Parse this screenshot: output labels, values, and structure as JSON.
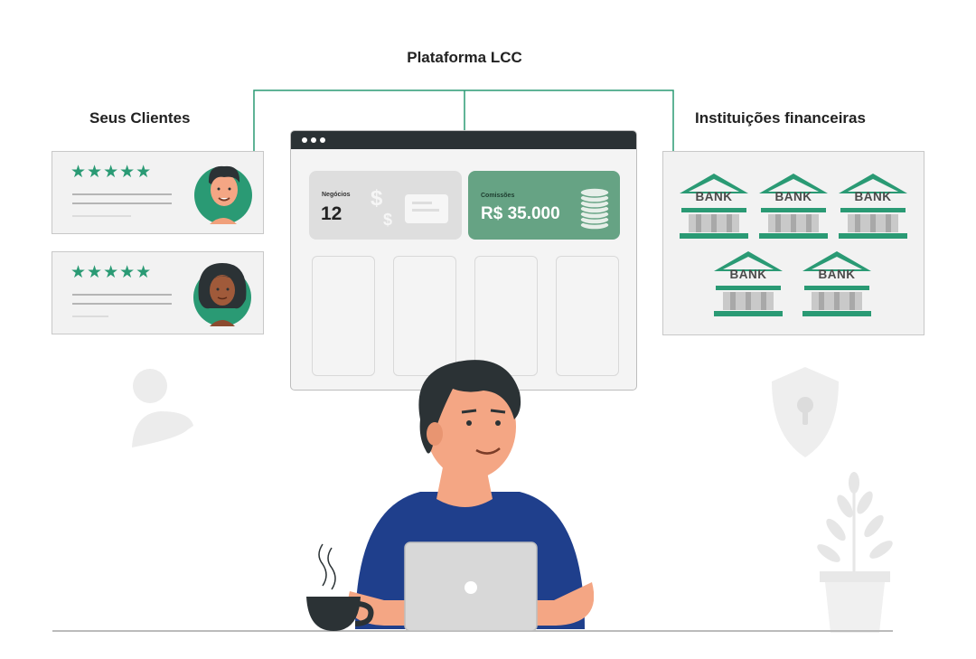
{
  "diagram": {
    "title": "Plataforma LCC",
    "left_label": "Seus Clientes",
    "right_label": "Instituições financeiras"
  },
  "clients": [
    {
      "rating": "★★★★★",
      "stars": 5
    },
    {
      "rating": "★★★★★",
      "stars": 5
    }
  ],
  "dashboard": {
    "deals_label": "Negócios",
    "deals_value": "12",
    "commission_label": "Comissões",
    "commission_value": "R$ 35.000"
  },
  "banks": [
    {
      "label": "BANK"
    },
    {
      "label": "BANK"
    },
    {
      "label": "BANK"
    },
    {
      "label": "BANK"
    },
    {
      "label": "BANK"
    }
  ],
  "colors": {
    "accent_green": "#2a9a74",
    "commission_tile": "#66a384",
    "browser_bar": "#2b3235",
    "shirt_blue": "#1f3f8c"
  }
}
